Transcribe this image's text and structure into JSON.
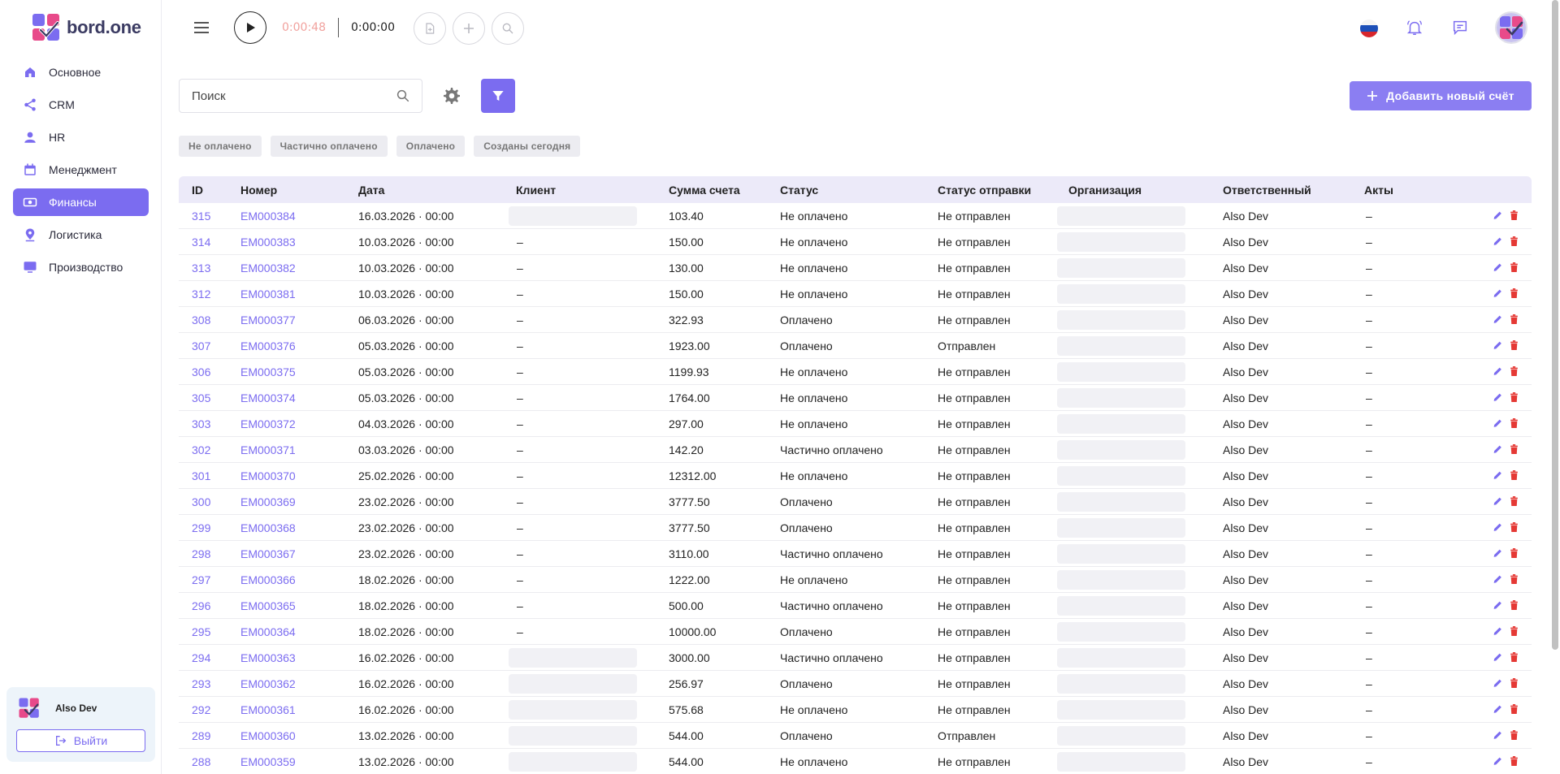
{
  "app": {
    "logo_text": "bord.one"
  },
  "sidebar": {
    "items": [
      {
        "label": "Основное",
        "icon": "home-icon",
        "active": false
      },
      {
        "label": "CRM",
        "icon": "share-icon",
        "active": false
      },
      {
        "label": "HR",
        "icon": "person-icon",
        "active": false
      },
      {
        "label": "Менеджмент",
        "icon": "calendar-icon",
        "active": false
      },
      {
        "label": "Финансы",
        "icon": "cash-icon",
        "active": true
      },
      {
        "label": "Логистика",
        "icon": "location-icon",
        "active": false
      },
      {
        "label": "Производство",
        "icon": "monitor-icon",
        "active": false
      }
    ],
    "user_name": "Also Dev",
    "logout_label": "Выйти"
  },
  "topbar": {
    "timer_running": "0:00:48",
    "timer_total": "0:00:00"
  },
  "toolbar": {
    "search_placeholder": "Поиск",
    "add_label": "Добавить новый счёт"
  },
  "filters": [
    "Не оплачено",
    "Частично оплачено",
    "Оплачено",
    "Созданы сегодня"
  ],
  "table": {
    "columns": [
      "ID",
      "Номер",
      "Дата",
      "Клиент",
      "Сумма счета",
      "Статус",
      "Статус отправки",
      "Организация",
      "Ответственный",
      "Акты"
    ],
    "rows": [
      {
        "id": "315",
        "num": "EM000384",
        "date": "16.03.2026 · 00:00",
        "client": "",
        "sum": "103.40",
        "status": "Не оплачено",
        "send": "Не отправлен",
        "resp": "Also Dev",
        "acts": "–"
      },
      {
        "id": "314",
        "num": "EM000383",
        "date": "10.03.2026 · 00:00",
        "client": "–",
        "sum": "150.00",
        "status": "Не оплачено",
        "send": "Не отправлен",
        "resp": "Also Dev",
        "acts": "–"
      },
      {
        "id": "313",
        "num": "EM000382",
        "date": "10.03.2026 · 00:00",
        "client": "–",
        "sum": "130.00",
        "status": "Не оплачено",
        "send": "Не отправлен",
        "resp": "Also Dev",
        "acts": "–"
      },
      {
        "id": "312",
        "num": "EM000381",
        "date": "10.03.2026 · 00:00",
        "client": "–",
        "sum": "150.00",
        "status": "Не оплачено",
        "send": "Не отправлен",
        "resp": "Also Dev",
        "acts": "–"
      },
      {
        "id": "308",
        "num": "EM000377",
        "date": "06.03.2026 · 00:00",
        "client": "–",
        "sum": "322.93",
        "status": "Оплачено",
        "send": "Не отправлен",
        "resp": "Also Dev",
        "acts": "–"
      },
      {
        "id": "307",
        "num": "EM000376",
        "date": "05.03.2026 · 00:00",
        "client": "–",
        "sum": "1923.00",
        "status": "Оплачено",
        "send": "Отправлен",
        "resp": "Also Dev",
        "acts": "–"
      },
      {
        "id": "306",
        "num": "EM000375",
        "date": "05.03.2026 · 00:00",
        "client": "–",
        "sum": "1199.93",
        "status": "Не оплачено",
        "send": "Не отправлен",
        "resp": "Also Dev",
        "acts": "–"
      },
      {
        "id": "305",
        "num": "EM000374",
        "date": "05.03.2026 · 00:00",
        "client": "–",
        "sum": "1764.00",
        "status": "Не оплачено",
        "send": "Не отправлен",
        "resp": "Also Dev",
        "acts": "–"
      },
      {
        "id": "303",
        "num": "EM000372",
        "date": "04.03.2026 · 00:00",
        "client": "–",
        "sum": "297.00",
        "status": "Не оплачено",
        "send": "Не отправлен",
        "resp": "Also Dev",
        "acts": "–"
      },
      {
        "id": "302",
        "num": "EM000371",
        "date": "03.03.2026 · 00:00",
        "client": "–",
        "sum": "142.20",
        "status": "Частично оплачено",
        "send": "Не отправлен",
        "resp": "Also Dev",
        "acts": "–"
      },
      {
        "id": "301",
        "num": "EM000370",
        "date": "25.02.2026 · 00:00",
        "client": "–",
        "sum": "12312.00",
        "status": "Не оплачено",
        "send": "Не отправлен",
        "resp": "Also Dev",
        "acts": "–"
      },
      {
        "id": "300",
        "num": "EM000369",
        "date": "23.02.2026 · 00:00",
        "client": "–",
        "sum": "3777.50",
        "status": "Оплачено",
        "send": "Не отправлен",
        "resp": "Also Dev",
        "acts": "–"
      },
      {
        "id": "299",
        "num": "EM000368",
        "date": "23.02.2026 · 00:00",
        "client": "–",
        "sum": "3777.50",
        "status": "Оплачено",
        "send": "Не отправлен",
        "resp": "Also Dev",
        "acts": "–"
      },
      {
        "id": "298",
        "num": "EM000367",
        "date": "23.02.2026 · 00:00",
        "client": "–",
        "sum": "3110.00",
        "status": "Частично оплачено",
        "send": "Не отправлен",
        "resp": "Also Dev",
        "acts": "–"
      },
      {
        "id": "297",
        "num": "EM000366",
        "date": "18.02.2026 · 00:00",
        "client": "–",
        "sum": "1222.00",
        "status": "Не оплачено",
        "send": "Не отправлен",
        "resp": "Also Dev",
        "acts": "–"
      },
      {
        "id": "296",
        "num": "EM000365",
        "date": "18.02.2026 · 00:00",
        "client": "–",
        "sum": "500.00",
        "status": "Частично оплачено",
        "send": "Не отправлен",
        "resp": "Also Dev",
        "acts": "–"
      },
      {
        "id": "295",
        "num": "EM000364",
        "date": "18.02.2026 · 00:00",
        "client": "–",
        "sum": "10000.00",
        "status": "Оплачено",
        "send": "Не отправлен",
        "resp": "Also Dev",
        "acts": "–"
      },
      {
        "id": "294",
        "num": "EM000363",
        "date": "16.02.2026 · 00:00",
        "client": "",
        "sum": "3000.00",
        "status": "Частично оплачено",
        "send": "Не отправлен",
        "resp": "Also Dev",
        "acts": "–"
      },
      {
        "id": "293",
        "num": "EM000362",
        "date": "16.02.2026 · 00:00",
        "client": "",
        "sum": "256.97",
        "status": "Оплачено",
        "send": "Не отправлен",
        "resp": "Also Dev",
        "acts": "–"
      },
      {
        "id": "292",
        "num": "EM000361",
        "date": "16.02.2026 · 00:00",
        "client": "",
        "sum": "575.68",
        "status": "Не оплачено",
        "send": "Не отправлен",
        "resp": "Also Dev",
        "acts": "–"
      },
      {
        "id": "289",
        "num": "EM000360",
        "date": "13.02.2026 · 00:00",
        "client": "",
        "sum": "544.00",
        "status": "Оплачено",
        "send": "Отправлен",
        "resp": "Also Dev",
        "acts": "–"
      },
      {
        "id": "288",
        "num": "EM000359",
        "date": "13.02.2026 · 00:00",
        "client": "",
        "sum": "544.00",
        "status": "Не оплачено",
        "send": "Не отправлен",
        "resp": "Also Dev",
        "acts": "–"
      }
    ]
  },
  "colors": {
    "accent": "#7b6cf0",
    "danger": "#e53935",
    "timer_red": "#f1a29e"
  }
}
